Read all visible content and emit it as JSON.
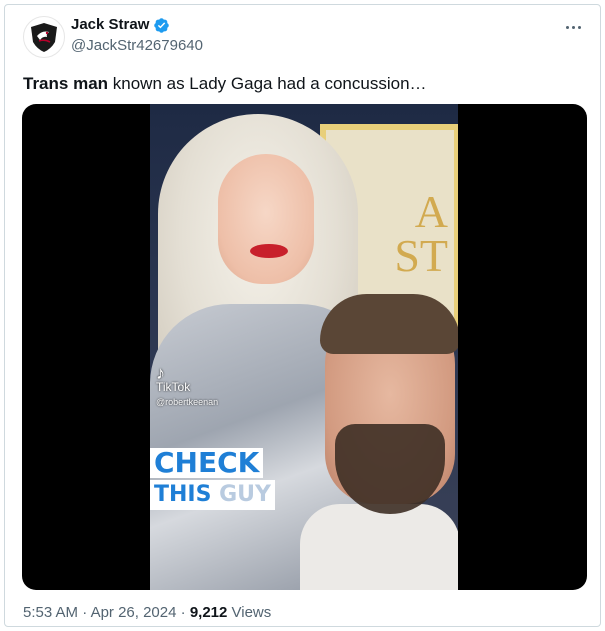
{
  "tweet": {
    "author": {
      "display_name": "Jack Straw",
      "handle": "@JackStr42679640",
      "verified": true,
      "avatar_icon": "blackbird-on-shield-icon"
    },
    "text_bold": "Trans man",
    "text_rest": " known as Lady Gaga had a concussion…",
    "media": {
      "watermark_brand": "TikTok",
      "watermark_user": "@robertkeenan",
      "caption_line1": "CHECK",
      "caption_line2": "THIS",
      "caption_line2_faded": "GUY",
      "background_sign_text": "A\nST"
    },
    "meta": {
      "time": "5:53 AM",
      "separator": " · ",
      "date": "Apr 26, 2024",
      "views_count": "9,212",
      "views_label": " Views"
    }
  },
  "colors": {
    "verified_badge": "#1d9bf0",
    "secondary_text": "#536471",
    "caption_blue": "#1f7fd6"
  }
}
